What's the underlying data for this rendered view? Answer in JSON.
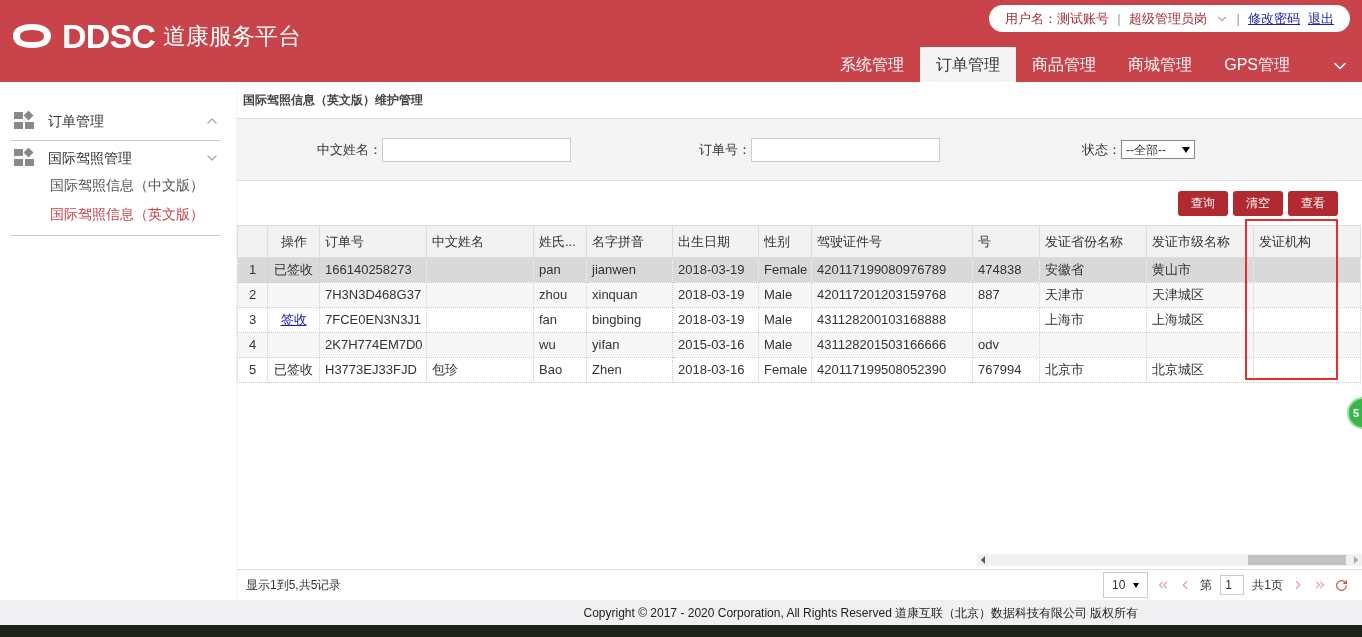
{
  "header": {
    "logo_text": "DDSC",
    "platform_name": "道康服务平台",
    "user_label": "用户名：测试账号",
    "separators": [
      "|",
      "|"
    ],
    "role": "超级管理员岗",
    "links": [
      "修改密码",
      "退出"
    ],
    "nav": [
      {
        "label": "系统管理",
        "selected": false
      },
      {
        "label": "订单管理",
        "selected": true
      },
      {
        "label": "商品管理",
        "selected": false
      },
      {
        "label": "商城管理",
        "selected": false
      },
      {
        "label": "GPS管理",
        "selected": false
      }
    ]
  },
  "sidebar": {
    "groups": [
      {
        "label": "订单管理",
        "expanded": true
      },
      {
        "label": "国际驾照管理",
        "expanded": false,
        "children": [
          {
            "label": "国际驾照信息（中文版）",
            "selected": false
          },
          {
            "label": "国际驾照信息（英文版）",
            "selected": true
          }
        ]
      }
    ]
  },
  "breadcrumb": "国际驾照信息（英文版）维护管理",
  "filters": [
    {
      "kind": "input",
      "label": "中文姓名："
    },
    {
      "kind": "input",
      "label": "订单号："
    },
    {
      "kind": "select",
      "label": "状态：",
      "value": "--全部--"
    }
  ],
  "buttons": [
    "查询",
    "清空",
    "查看"
  ],
  "table": {
    "columns": [
      "",
      "操作",
      "订单号",
      "中文姓名",
      "姓氏...",
      "名字拼音",
      "出生日期",
      "性别",
      "驾驶证件号",
      "号",
      "发证省份名称",
      "发证市级名称",
      "发证机构"
    ],
    "rows": [
      {
        "selected": true,
        "kind": "text",
        "cells": [
          "1",
          "已签收",
          "166140258273",
          null,
          "pan",
          "jianwen",
          "2018-03-19",
          "Female",
          "420117199080976789",
          "474838",
          "安徽省",
          "黄山市",
          null
        ]
      },
      {
        "selected": false,
        "cells": [
          "2",
          null,
          "7H3N3D468G37",
          null,
          "zhou",
          "xinquan",
          "2018-03-19",
          "Male",
          "420117201203159768",
          "887",
          "天津市",
          "天津城区",
          null
        ]
      },
      {
        "selected": false,
        "kind": "link",
        "cells": [
          "3",
          "签收",
          "7FCE0EN3N3J1",
          null,
          "fan",
          "bingbing",
          "2018-03-19",
          "Male",
          "431128200103168888",
          null,
          "上海市",
          "上海城区",
          null
        ]
      },
      {
        "selected": false,
        "cells": [
          "4",
          null,
          "2K7H774EM7D0",
          null,
          "wu",
          "yifan",
          "2015-03-16",
          "Male",
          "431128201503166666",
          "odv",
          null,
          null,
          null
        ]
      },
      {
        "selected": false,
        "kind": "text",
        "cells": [
          "5",
          "已签收",
          "H3773EJ33FJD",
          "包珍",
          "Bao",
          "Zhen",
          "2018-03-16",
          "Female",
          "420117199508052390",
          "767994",
          "北京市",
          "北京城区",
          null
        ]
      }
    ]
  },
  "status": "显示1到5,共5记录",
  "pagination": {
    "page_size": "10",
    "page_prefix": "第",
    "page": "1",
    "total": "共1页"
  },
  "badge": "5",
  "copyright": "Copyright © 2017 - 2020 Corporation, All Rights Reserved 道康互联（北京）数据科技有限公司 版权所有"
}
